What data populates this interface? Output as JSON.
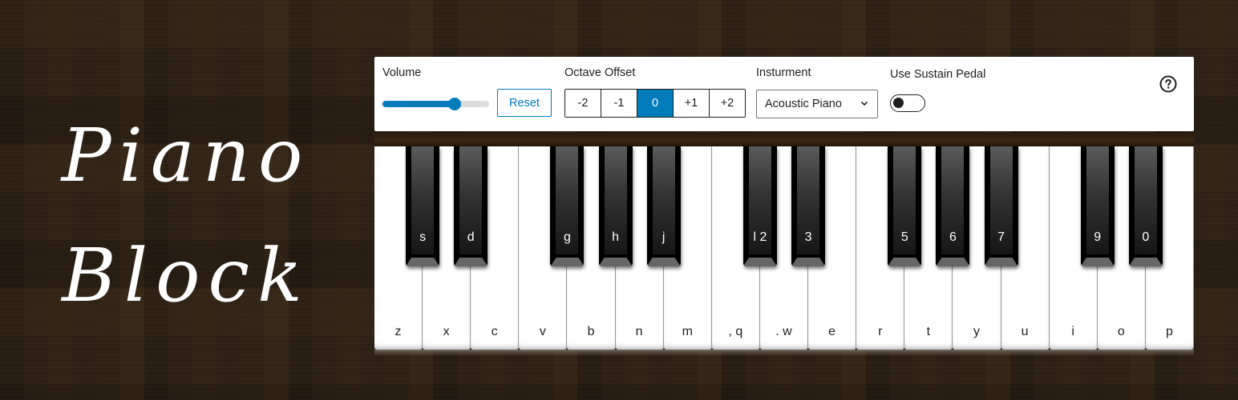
{
  "branding": {
    "title_line1": "Piano",
    "title_line2": "Block"
  },
  "controls": {
    "volume": {
      "label": "Volume",
      "value_fraction": 0.68,
      "reset_label": "Reset"
    },
    "octave": {
      "label": "Octave Offset",
      "options": [
        "-2",
        "-1",
        "0",
        "+1",
        "+2"
      ],
      "selected": "0"
    },
    "instrument": {
      "label": "Insturment",
      "selected": "Acoustic Piano",
      "icon": "chevron-down-icon"
    },
    "sustain": {
      "label": "Use Sustain Pedal",
      "enabled": false
    },
    "help_icon": "question-circle-icon"
  },
  "colors": {
    "accent": "#007cba",
    "panel_bg": "#ffffff",
    "wood_bg": "#2f2317"
  },
  "piano": {
    "white_keys": [
      "z",
      "x",
      "c",
      "v",
      "b",
      "n",
      "m",
      ", q",
      ". w",
      "e",
      "r",
      "t",
      "y",
      "u",
      "i",
      "o",
      "p"
    ],
    "black_keys": [
      {
        "label": "s",
        "after_white": 0
      },
      {
        "label": "d",
        "after_white": 1
      },
      {
        "label": "g",
        "after_white": 3
      },
      {
        "label": "h",
        "after_white": 4
      },
      {
        "label": "j",
        "after_white": 5
      },
      {
        "label": "l 2",
        "after_white": 7
      },
      {
        "label": "3",
        "after_white": 8
      },
      {
        "label": "5",
        "after_white": 10
      },
      {
        "label": "6",
        "after_white": 11
      },
      {
        "label": "7",
        "after_white": 12
      },
      {
        "label": "9",
        "after_white": 14
      },
      {
        "label": "0",
        "after_white": 15
      }
    ]
  }
}
